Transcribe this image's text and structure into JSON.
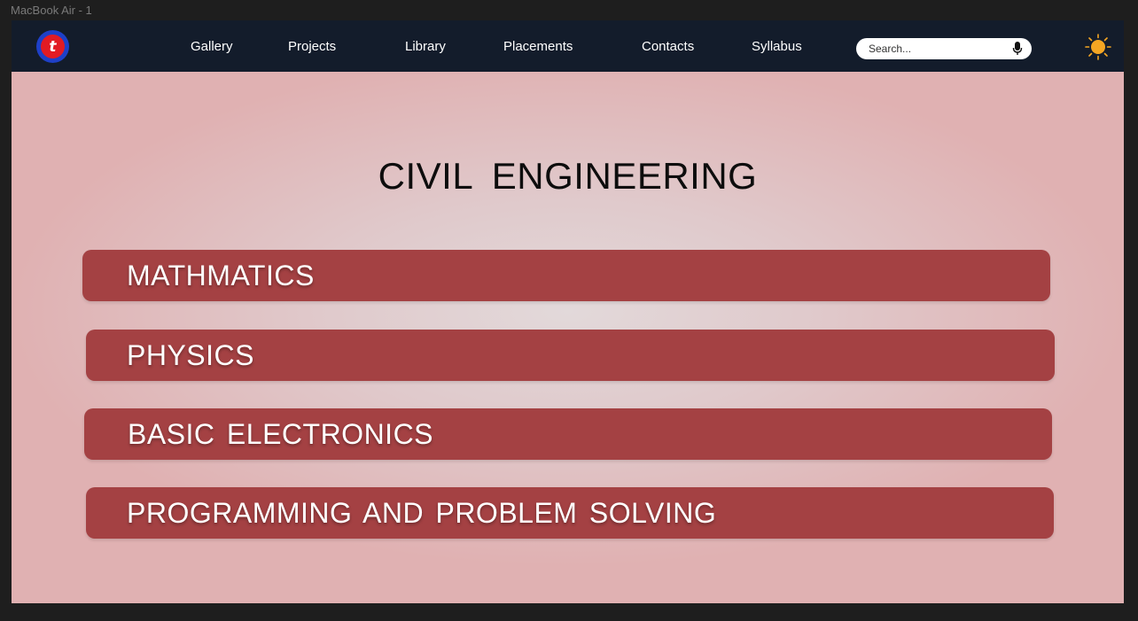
{
  "frame_label": "MacBook Air - 1",
  "logo": {
    "text": "t",
    "icon": "college-logo-icon"
  },
  "nav": {
    "links": [
      "Gallery",
      "Projects",
      "Library",
      "Placements",
      "Contacts",
      "Syllabus"
    ]
  },
  "search": {
    "placeholder": "Search...",
    "value": "",
    "icon": "microphone-icon"
  },
  "theme_toggle": {
    "icon": "sun-icon",
    "color": "#f5a623"
  },
  "page": {
    "title": "CIVIL  ENGINEERING"
  },
  "subjects": [
    "MATHMATICS",
    "PHYSICS",
    "BASIC  ELECTRONICS",
    "PROGRAMMING AND PROBLEM SOLVING"
  ],
  "colors": {
    "navbar": "#131c2b",
    "subject_button": "#a44143",
    "background_edge": "#e0b1b2",
    "background_center": "#e2d9da"
  }
}
